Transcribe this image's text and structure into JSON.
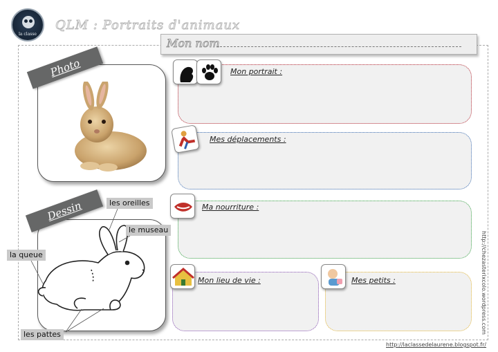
{
  "header": {
    "logo_caption": "la classe",
    "title": "QLM : Portraits d'animaux"
  },
  "name_bar": {
    "label": "Mon nom"
  },
  "photo": {
    "label": "Photo"
  },
  "drawing": {
    "label": "Dessin",
    "tags": {
      "ears": "les oreilles",
      "muzzle": "le museau",
      "tail": "la queue",
      "paws": "les pattes"
    }
  },
  "sections": {
    "portrait": "Mon portrait :",
    "deplacements": "Mes déplacements :",
    "nourriture": "Ma nourriture :",
    "lieu": "Mon lieu de vie :",
    "petits": "Mes petits :"
  },
  "colors": {
    "portrait": "#b82b36",
    "deplacements": "#3d6fb4",
    "nourriture": "#3aa548",
    "lieu": "#8a53b4",
    "petits": "#e6b93a",
    "ribbon": "#666767"
  },
  "icons": {
    "portrait": [
      "silhouette-icon",
      "paw-print-icon"
    ],
    "deplacements": "running-figure-icon",
    "nourriture": "mouth-icon",
    "lieu": "house-icon",
    "petits": "baby-icon"
  },
  "footer": {
    "url_right": "http://chezasterixcolo.wordpress.com",
    "url_bottom": "http://laclassedelaurene.blogspot.fr/"
  }
}
